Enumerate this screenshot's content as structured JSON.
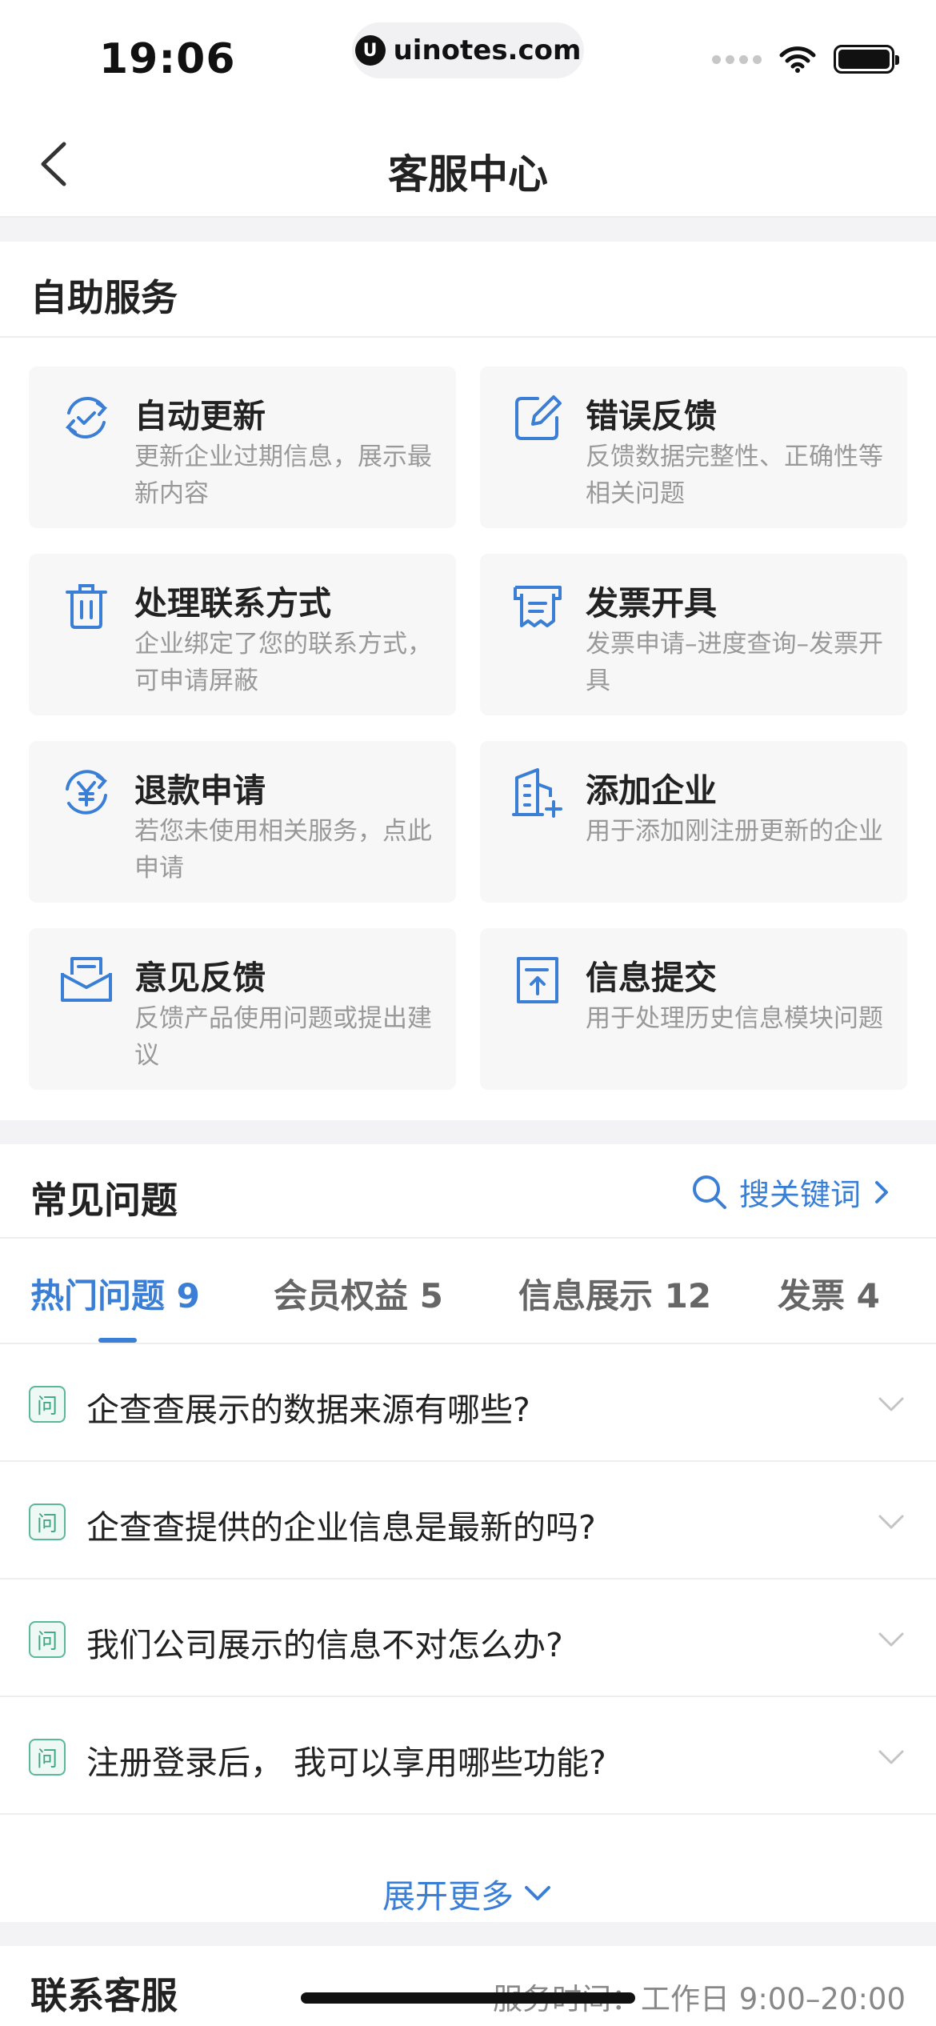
{
  "status_bar": {
    "time": "19:06",
    "url": "uinotes.com",
    "url_logo_letter": "U"
  },
  "nav": {
    "title": "客服中心"
  },
  "self_service": {
    "title": "自助服务",
    "tiles": [
      {
        "icon": "refresh-check-icon",
        "title": "自动更新",
        "desc": "更新企业过期信息，展示最新内容"
      },
      {
        "icon": "edit-icon",
        "title": "错误反馈",
        "desc": "反馈数据完整性、正确性等相关问题"
      },
      {
        "icon": "trash-icon",
        "title": "处理联系方式",
        "desc": "企业绑定了您的联系方式，可申请屏蔽"
      },
      {
        "icon": "invoice-icon",
        "title": "发票开具",
        "desc": "发票申请–进度查询–发票开具"
      },
      {
        "icon": "yen-refund-icon",
        "title": "退款申请",
        "desc": "若您未使用相关服务，点此申请"
      },
      {
        "icon": "building-add-icon",
        "title": "添加企业",
        "desc": "用于添加刚注册更新的企业"
      },
      {
        "icon": "mail-icon",
        "title": "意见反馈",
        "desc": "反馈产品使用问题或提出建议"
      },
      {
        "icon": "document-upload-icon",
        "title": "信息提交",
        "desc": "用于处理历史信息模块问题"
      }
    ]
  },
  "faq": {
    "title": "常见问题",
    "search_label": "搜关键词",
    "tabs": [
      {
        "label": "热门问题 9",
        "active": true
      },
      {
        "label": "会员权益 5",
        "active": false
      },
      {
        "label": "信息展示 12",
        "active": false
      },
      {
        "label": "发票 4",
        "active": false
      }
    ],
    "question_badge": "问",
    "items": [
      "企查查展示的数据来源有哪些?",
      "企查查提供的企业信息是最新的吗?",
      "我们公司展示的信息不对怎么办?",
      "注册登录后， 我可以享用哪些功能?"
    ],
    "expand_label": "展开更多"
  },
  "contact": {
    "title": "联系客服",
    "hours": "服务时间：工作日 9:00–20:00"
  },
  "colors": {
    "accent": "#3a7fd5",
    "badge": "#3fa583"
  }
}
